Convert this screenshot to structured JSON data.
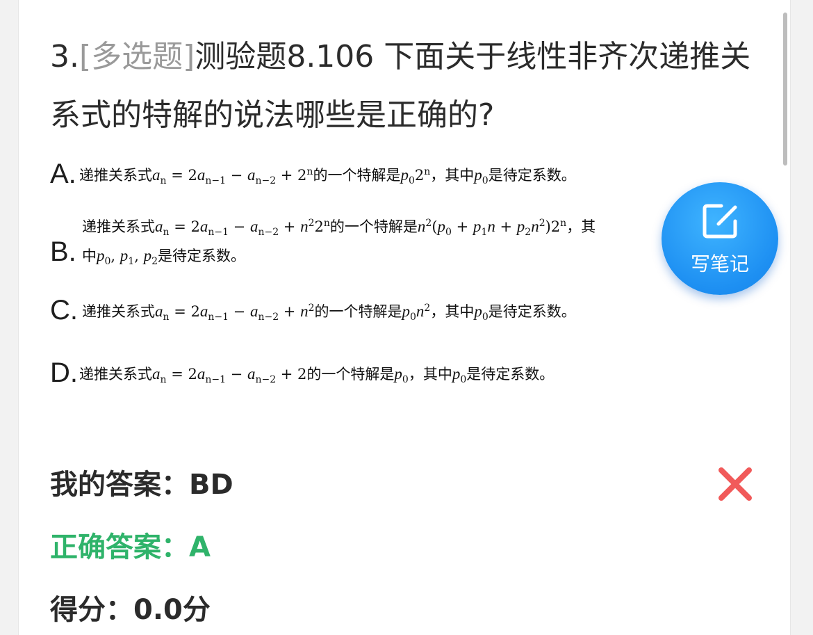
{
  "question": {
    "number": "3.",
    "type_tag": "[多选题]",
    "text": "测验题8.106 下面关于线性非齐次递推关系式的特解的说法哪些是正确的?"
  },
  "options": [
    {
      "letter": "A."
    },
    {
      "letter": "B."
    },
    {
      "letter": "C."
    },
    {
      "letter": "D."
    }
  ],
  "note_button": {
    "label": "写笔记",
    "icon": "edit-note-icon"
  },
  "result": {
    "my_answer_label": "我的答案：",
    "my_answer_value": "BD",
    "correct_answer_label": "正确答案：",
    "correct_answer_value": "A",
    "score_label": "得分：",
    "score_value": "0.0分",
    "status_icon": "wrong-x-icon"
  },
  "colors": {
    "correct": "#2fb36a",
    "wrong": "#f15a5a",
    "note_button": "#1d8ff2",
    "tag": "#9a9a9a"
  }
}
